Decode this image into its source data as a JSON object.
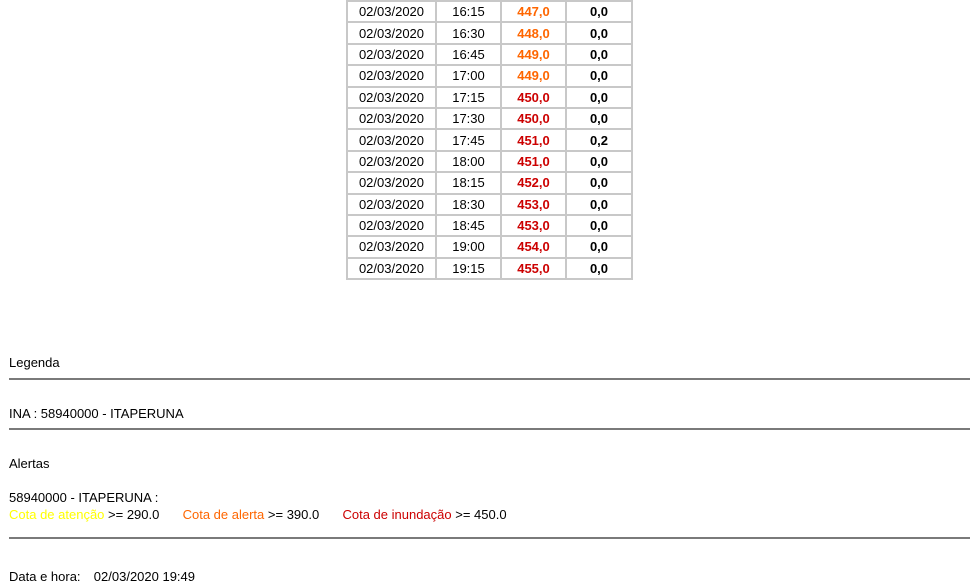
{
  "colors": {
    "attention": "#ffff00",
    "alert": "#ff6600",
    "flood": "#cc0000"
  },
  "table": {
    "rows": [
      {
        "date": "02/03/2020",
        "time": "16:15",
        "level": "447,0",
        "status": "alert",
        "rain": "0,0"
      },
      {
        "date": "02/03/2020",
        "time": "16:30",
        "level": "448,0",
        "status": "alert",
        "rain": "0,0"
      },
      {
        "date": "02/03/2020",
        "time": "16:45",
        "level": "449,0",
        "status": "alert",
        "rain": "0,0"
      },
      {
        "date": "02/03/2020",
        "time": "17:00",
        "level": "449,0",
        "status": "alert",
        "rain": "0,0"
      },
      {
        "date": "02/03/2020",
        "time": "17:15",
        "level": "450,0",
        "status": "flood",
        "rain": "0,0"
      },
      {
        "date": "02/03/2020",
        "time": "17:30",
        "level": "450,0",
        "status": "flood",
        "rain": "0,0"
      },
      {
        "date": "02/03/2020",
        "time": "17:45",
        "level": "451,0",
        "status": "flood",
        "rain": "0,2"
      },
      {
        "date": "02/03/2020",
        "time": "18:00",
        "level": "451,0",
        "status": "flood",
        "rain": "0,0"
      },
      {
        "date": "02/03/2020",
        "time": "18:15",
        "level": "452,0",
        "status": "flood",
        "rain": "0,0"
      },
      {
        "date": "02/03/2020",
        "time": "18:30",
        "level": "453,0",
        "status": "flood",
        "rain": "0,0"
      },
      {
        "date": "02/03/2020",
        "time": "18:45",
        "level": "453,0",
        "status": "flood",
        "rain": "0,0"
      },
      {
        "date": "02/03/2020",
        "time": "19:00",
        "level": "454,0",
        "status": "flood",
        "rain": "0,0"
      },
      {
        "date": "02/03/2020",
        "time": "19:15",
        "level": "455,0",
        "status": "flood",
        "rain": "0,0"
      }
    ]
  },
  "legend": {
    "heading": "Legenda",
    "ina_line": "INA : 58940000 - ITAPERUNA"
  },
  "alerts": {
    "heading": "Alertas",
    "station": "58940000 - ITAPERUNA :",
    "attention_label": "Cota de atenção",
    "attention_value": ">= 290.0",
    "alert_label": "Cota de alerta",
    "alert_value": ">= 390.0",
    "flood_label": "Cota de inundação",
    "flood_value": ">= 450.0"
  },
  "footer": {
    "datetime_label": "Data e hora:",
    "datetime_value": "02/03/2020 19:49"
  }
}
